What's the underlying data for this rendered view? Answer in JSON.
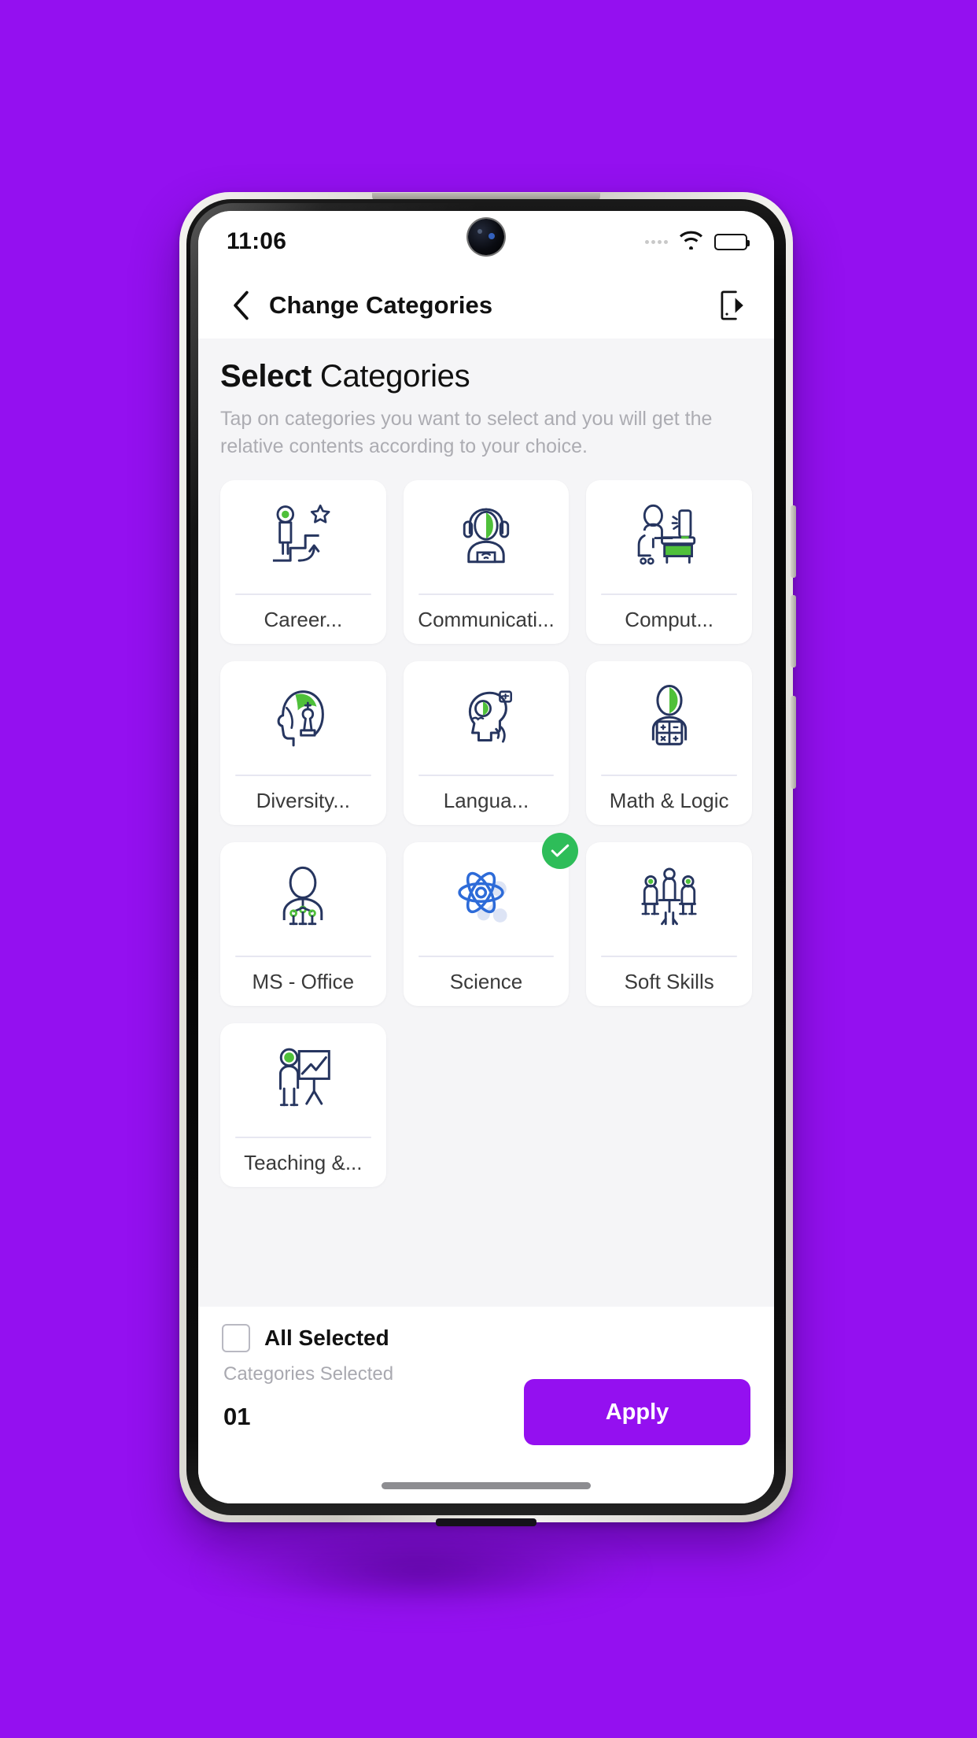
{
  "theme": {
    "background": "#9410F0",
    "accent": "#9410F0",
    "selected_badge": "#2EBD59",
    "card_bg": "#FFFFFF",
    "body_bg": "#F5F5F7",
    "icon_navy": "#26355F",
    "icon_green": "#4FC03A",
    "icon_blue": "#2D6BD8"
  },
  "status_bar": {
    "time": "11:06",
    "signal_icon": "signal-dots-icon",
    "wifi_icon": "wifi-icon",
    "battery_icon": "battery-full-icon",
    "camera_icon": "front-camera-punch-hole"
  },
  "header": {
    "back_icon": "chevron-left-icon",
    "title": "Change Categories",
    "action_icon": "logout-device-icon"
  },
  "page": {
    "title_bold": "Select",
    "title_regular": "Categories",
    "description": "Tap on categories you want to select and you will get the relative contents according to your choice."
  },
  "categories": [
    {
      "label": "Career...",
      "icon": "career-growth-icon",
      "selected": false
    },
    {
      "label": "Communicati...",
      "icon": "headset-support-icon",
      "selected": false
    },
    {
      "label": "Comput...",
      "icon": "computer-desk-icon",
      "selected": false
    },
    {
      "label": "Diversity...",
      "icon": "diversity-chess-icon",
      "selected": false
    },
    {
      "label": "Langua...",
      "icon": "language-speech-icon",
      "selected": false
    },
    {
      "label": "Math & Logic",
      "icon": "calculator-person-icon",
      "selected": false
    },
    {
      "label": "MS - Office",
      "icon": "office-person-icon",
      "selected": false
    },
    {
      "label": "Science",
      "icon": "atom-icon",
      "selected": true
    },
    {
      "label": "Soft Skills",
      "icon": "team-meeting-icon",
      "selected": false
    },
    {
      "label": "Teaching &...",
      "icon": "teaching-board-icon",
      "selected": false
    }
  ],
  "footer": {
    "all_selected_label": "All Selected",
    "all_selected_checked": false,
    "categories_selected_label": "Categories Selected",
    "count": "01",
    "apply_label": "Apply",
    "home_indicator": "home-indicator"
  }
}
